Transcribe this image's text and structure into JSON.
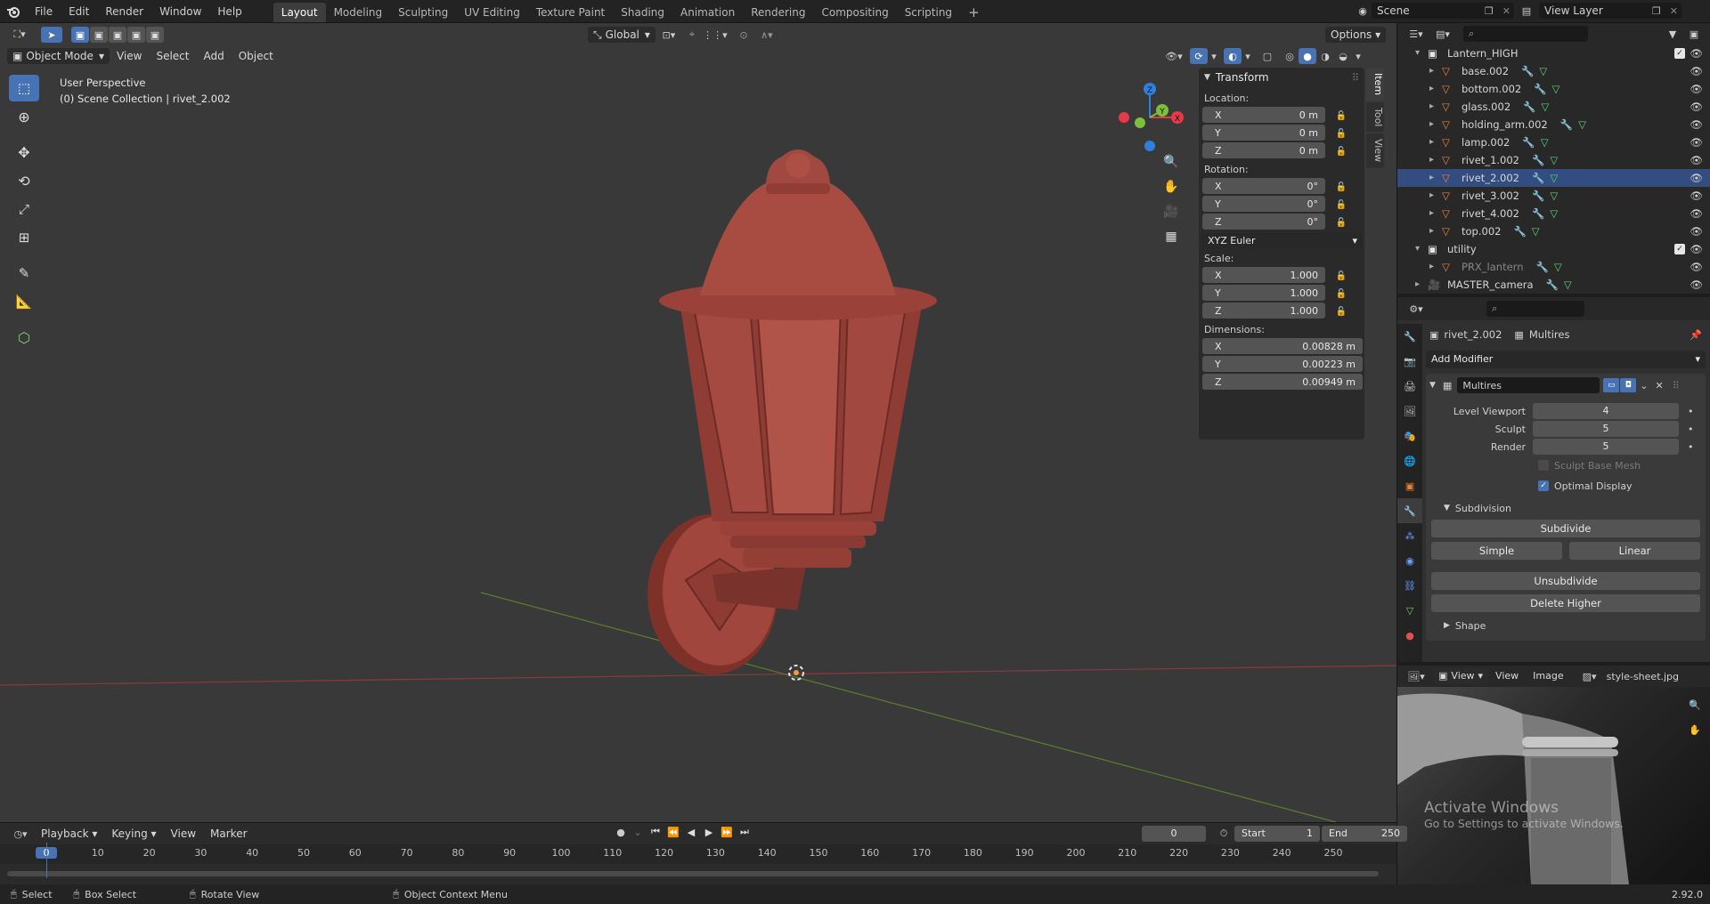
{
  "app": {
    "menu": [
      "File",
      "Edit",
      "Render",
      "Window",
      "Help"
    ],
    "workspaces": [
      "Layout",
      "Modeling",
      "Sculpting",
      "UV Editing",
      "Texture Paint",
      "Shading",
      "Animation",
      "Rendering",
      "Compositing",
      "Scripting"
    ],
    "active_workspace": "Layout",
    "add_workspace": "+",
    "scene_name": "Scene",
    "view_layer": "View Layer"
  },
  "viewport": {
    "mode": "Object Mode",
    "menus": [
      "View",
      "Select",
      "Add",
      "Object"
    ],
    "transform_orientation": "Global",
    "options_label": "Options",
    "overlay_line1": "User Perspective",
    "overlay_line2": "(0) Scene Collection | rivet_2.002",
    "gizmo": {
      "x": "X",
      "y": "Y",
      "z": "Z"
    },
    "colors": {
      "x_axis": "#e8394a",
      "y_axis": "#7cbf3a",
      "z_axis": "#2e7fe0",
      "object": "#a0463d"
    }
  },
  "npanel": {
    "title": "Transform",
    "location_label": "Location:",
    "location": [
      {
        "axis": "X",
        "value": "0 m"
      },
      {
        "axis": "Y",
        "value": "0 m"
      },
      {
        "axis": "Z",
        "value": "0 m"
      }
    ],
    "rotation_label": "Rotation:",
    "rotation": [
      {
        "axis": "X",
        "value": "0°"
      },
      {
        "axis": "Y",
        "value": "0°"
      },
      {
        "axis": "Z",
        "value": "0°"
      }
    ],
    "rotation_mode": "XYZ Euler",
    "scale_label": "Scale:",
    "scale": [
      {
        "axis": "X",
        "value": "1.000"
      },
      {
        "axis": "Y",
        "value": "1.000"
      },
      {
        "axis": "Z",
        "value": "1.000"
      }
    ],
    "dimensions_label": "Dimensions:",
    "dimensions": [
      {
        "axis": "X",
        "value": "0.00828 m"
      },
      {
        "axis": "Y",
        "value": "0.00223 m"
      },
      {
        "axis": "Z",
        "value": "0.00949 m"
      }
    ],
    "tabs": [
      "Item",
      "Tool",
      "View"
    ]
  },
  "outliner": {
    "rows": [
      {
        "name": "Lantern_HIGH",
        "kind": "collection"
      },
      {
        "name": "base.002",
        "kind": "mesh"
      },
      {
        "name": "bottom.002",
        "kind": "mesh"
      },
      {
        "name": "glass.002",
        "kind": "mesh"
      },
      {
        "name": "holding_arm.002",
        "kind": "mesh"
      },
      {
        "name": "lamp.002",
        "kind": "mesh"
      },
      {
        "name": "rivet_1.002",
        "kind": "mesh"
      },
      {
        "name": "rivet_2.002",
        "kind": "mesh"
      },
      {
        "name": "rivet_3.002",
        "kind": "mesh"
      },
      {
        "name": "rivet_4.002",
        "kind": "mesh"
      },
      {
        "name": "top.002",
        "kind": "mesh"
      },
      {
        "name": "utility",
        "kind": "collection"
      },
      {
        "name": "PRX_lantern",
        "kind": "mesh-dim"
      },
      {
        "name": "MASTER_camera",
        "kind": "camera"
      }
    ]
  },
  "properties": {
    "object_name": "rivet_2.002",
    "modifier_crumb": "Multires",
    "add_modifier": "Add Modifier",
    "modifier_name": "Multires",
    "level_viewport_label": "Level Viewport",
    "level_viewport": "4",
    "sculpt_label": "Sculpt",
    "sculpt": "5",
    "render_label": "Render",
    "render": "5",
    "sculpt_base_mesh": "Sculpt Base Mesh",
    "optimal_display": "Optimal Display",
    "subdivision_header": "Subdivision",
    "subdivide": "Subdivide",
    "simple": "Simple",
    "linear": "Linear",
    "unsubdivide": "Unsubdivide",
    "delete_higher": "Delete Higher",
    "shape_header": "Shape"
  },
  "image_editor": {
    "view_menu1": "View",
    "view_menu2": "View",
    "image_menu": "Image",
    "image_name": "style-sheet.jpg",
    "watermark1": "Activate Windows",
    "watermark2": "Go to Settings to activate Windows."
  },
  "timeline": {
    "menus": [
      "Playback",
      "Keying",
      "View",
      "Marker"
    ],
    "current_frame": "0",
    "start_label": "Start",
    "start": "1",
    "end_label": "End",
    "end": "250",
    "ticks": [
      "0",
      "10",
      "20",
      "30",
      "40",
      "50",
      "60",
      "70",
      "80",
      "90",
      "100",
      "110",
      "120",
      "130",
      "140",
      "150",
      "160",
      "170",
      "180",
      "190",
      "200",
      "210",
      "220",
      "230",
      "240",
      "250"
    ]
  },
  "statusbar": {
    "select": "Select",
    "box_select": "Box Select",
    "rotate_view": "Rotate View",
    "context_menu": "Object Context Menu",
    "version": "2.92.0"
  }
}
